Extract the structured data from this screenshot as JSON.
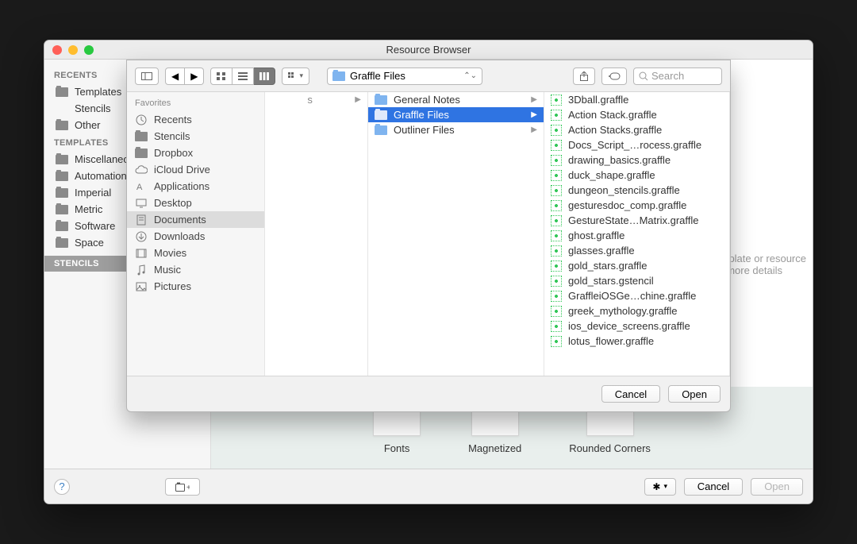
{
  "window": {
    "title": "Resource Browser"
  },
  "sidebar": {
    "recents_hdr": "RECENTS",
    "recents": [
      {
        "label": "Templates"
      },
      {
        "label": "Stencils"
      },
      {
        "label": "Other"
      }
    ],
    "templates_hdr": "TEMPLATES",
    "templates": [
      {
        "label": "Miscellaneous"
      },
      {
        "label": "Automation"
      },
      {
        "label": "Imperial"
      },
      {
        "label": "Metric"
      },
      {
        "label": "Software"
      },
      {
        "label": "Space"
      }
    ],
    "stencils_hdr": "STENCILS"
  },
  "main_note": {
    "l1": "Select a template or resource",
    "l2": "to see more details"
  },
  "thumbs": [
    {
      "label": "Fonts"
    },
    {
      "label": "Magnetized"
    },
    {
      "label": "Rounded Corners"
    }
  ],
  "bottom": {
    "cancel": "Cancel",
    "open": "Open"
  },
  "sheet": {
    "path_label": "Graffle Files",
    "search_ph": "Search",
    "favorites_hdr": "Favorites",
    "favorites": [
      {
        "label": "Recents",
        "icon": "clock"
      },
      {
        "label": "Stencils",
        "icon": "folder"
      },
      {
        "label": "Dropbox",
        "icon": "folder"
      },
      {
        "label": "iCloud Drive",
        "icon": "cloud"
      },
      {
        "label": "Applications",
        "icon": "app"
      },
      {
        "label": "Desktop",
        "icon": "desktop"
      },
      {
        "label": "Documents",
        "icon": "doc",
        "active": true
      },
      {
        "label": "Downloads",
        "icon": "download"
      },
      {
        "label": "Movies",
        "icon": "movie"
      },
      {
        "label": "Music",
        "icon": "music"
      },
      {
        "label": "Pictures",
        "icon": "picture"
      }
    ],
    "mid_trail": "s",
    "folders": [
      {
        "label": "General Notes"
      },
      {
        "label": "Graffle Files",
        "selected": true
      },
      {
        "label": "Outliner Files"
      }
    ],
    "files": [
      "3Dball.graffle",
      "Action Stack.graffle",
      "Action Stacks.graffle",
      "Docs_Script_…rocess.graffle",
      "drawing_basics.graffle",
      "duck_shape.graffle",
      "dungeon_stencils.graffle",
      "gesturesdoc_comp.graffle",
      "GestureState…Matrix.graffle",
      "ghost.graffle",
      "glasses.graffle",
      "gold_stars.graffle",
      "gold_stars.gstencil",
      "GraffleiOSGe…chine.graffle",
      "greek_mythology.graffle",
      "ios_device_screens.graffle",
      "lotus_flower.graffle"
    ],
    "cancel": "Cancel",
    "open": "Open"
  }
}
